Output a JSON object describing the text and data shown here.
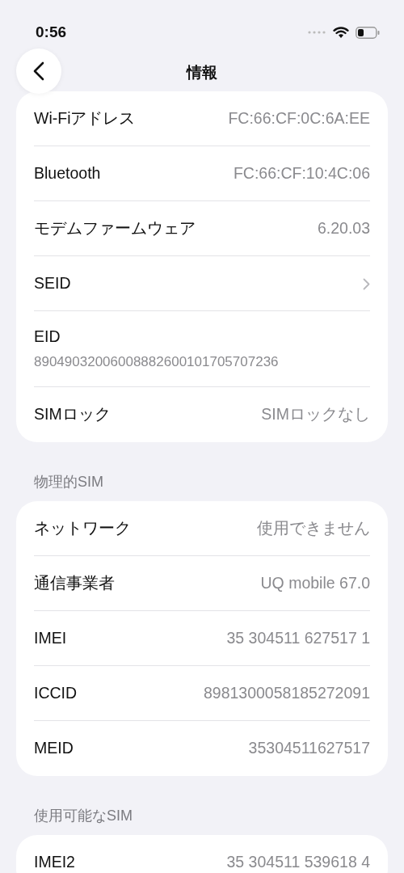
{
  "status_bar": {
    "time": "0:56"
  },
  "nav": {
    "title": "情報"
  },
  "sections": [
    {
      "rows": [
        {
          "kind": "value",
          "label": "Wi-Fiアドレス",
          "value": "FC:66:CF:0C:6A:EE"
        },
        {
          "kind": "value",
          "label": "Bluetooth",
          "value": "FC:66:CF:10:4C:06"
        },
        {
          "kind": "value",
          "label": "モデムファームウェア",
          "value": "6.20.03"
        },
        {
          "kind": "link",
          "label": "SEID"
        },
        {
          "kind": "stacked",
          "label": "EID",
          "value": "89049032006008882600101705707236"
        },
        {
          "kind": "value",
          "label": "SIMロック",
          "value": "SIMロックなし"
        }
      ]
    },
    {
      "header": "物理的SIM",
      "rows": [
        {
          "kind": "value",
          "label": "ネットワーク",
          "value": "使用できません"
        },
        {
          "kind": "value",
          "label": "通信事業者",
          "value": "UQ mobile 67.0"
        },
        {
          "kind": "value",
          "label": "IMEI",
          "value": "35 304511 627517 1"
        },
        {
          "kind": "value",
          "label": "ICCID",
          "value": "8981300058185272091"
        },
        {
          "kind": "value",
          "label": "MEID",
          "value": "35304511627517"
        }
      ]
    },
    {
      "header": "使用可能なSIM",
      "rows": [
        {
          "kind": "value",
          "label": "IMEI2",
          "value": "35 304511 539618 4"
        }
      ]
    }
  ]
}
